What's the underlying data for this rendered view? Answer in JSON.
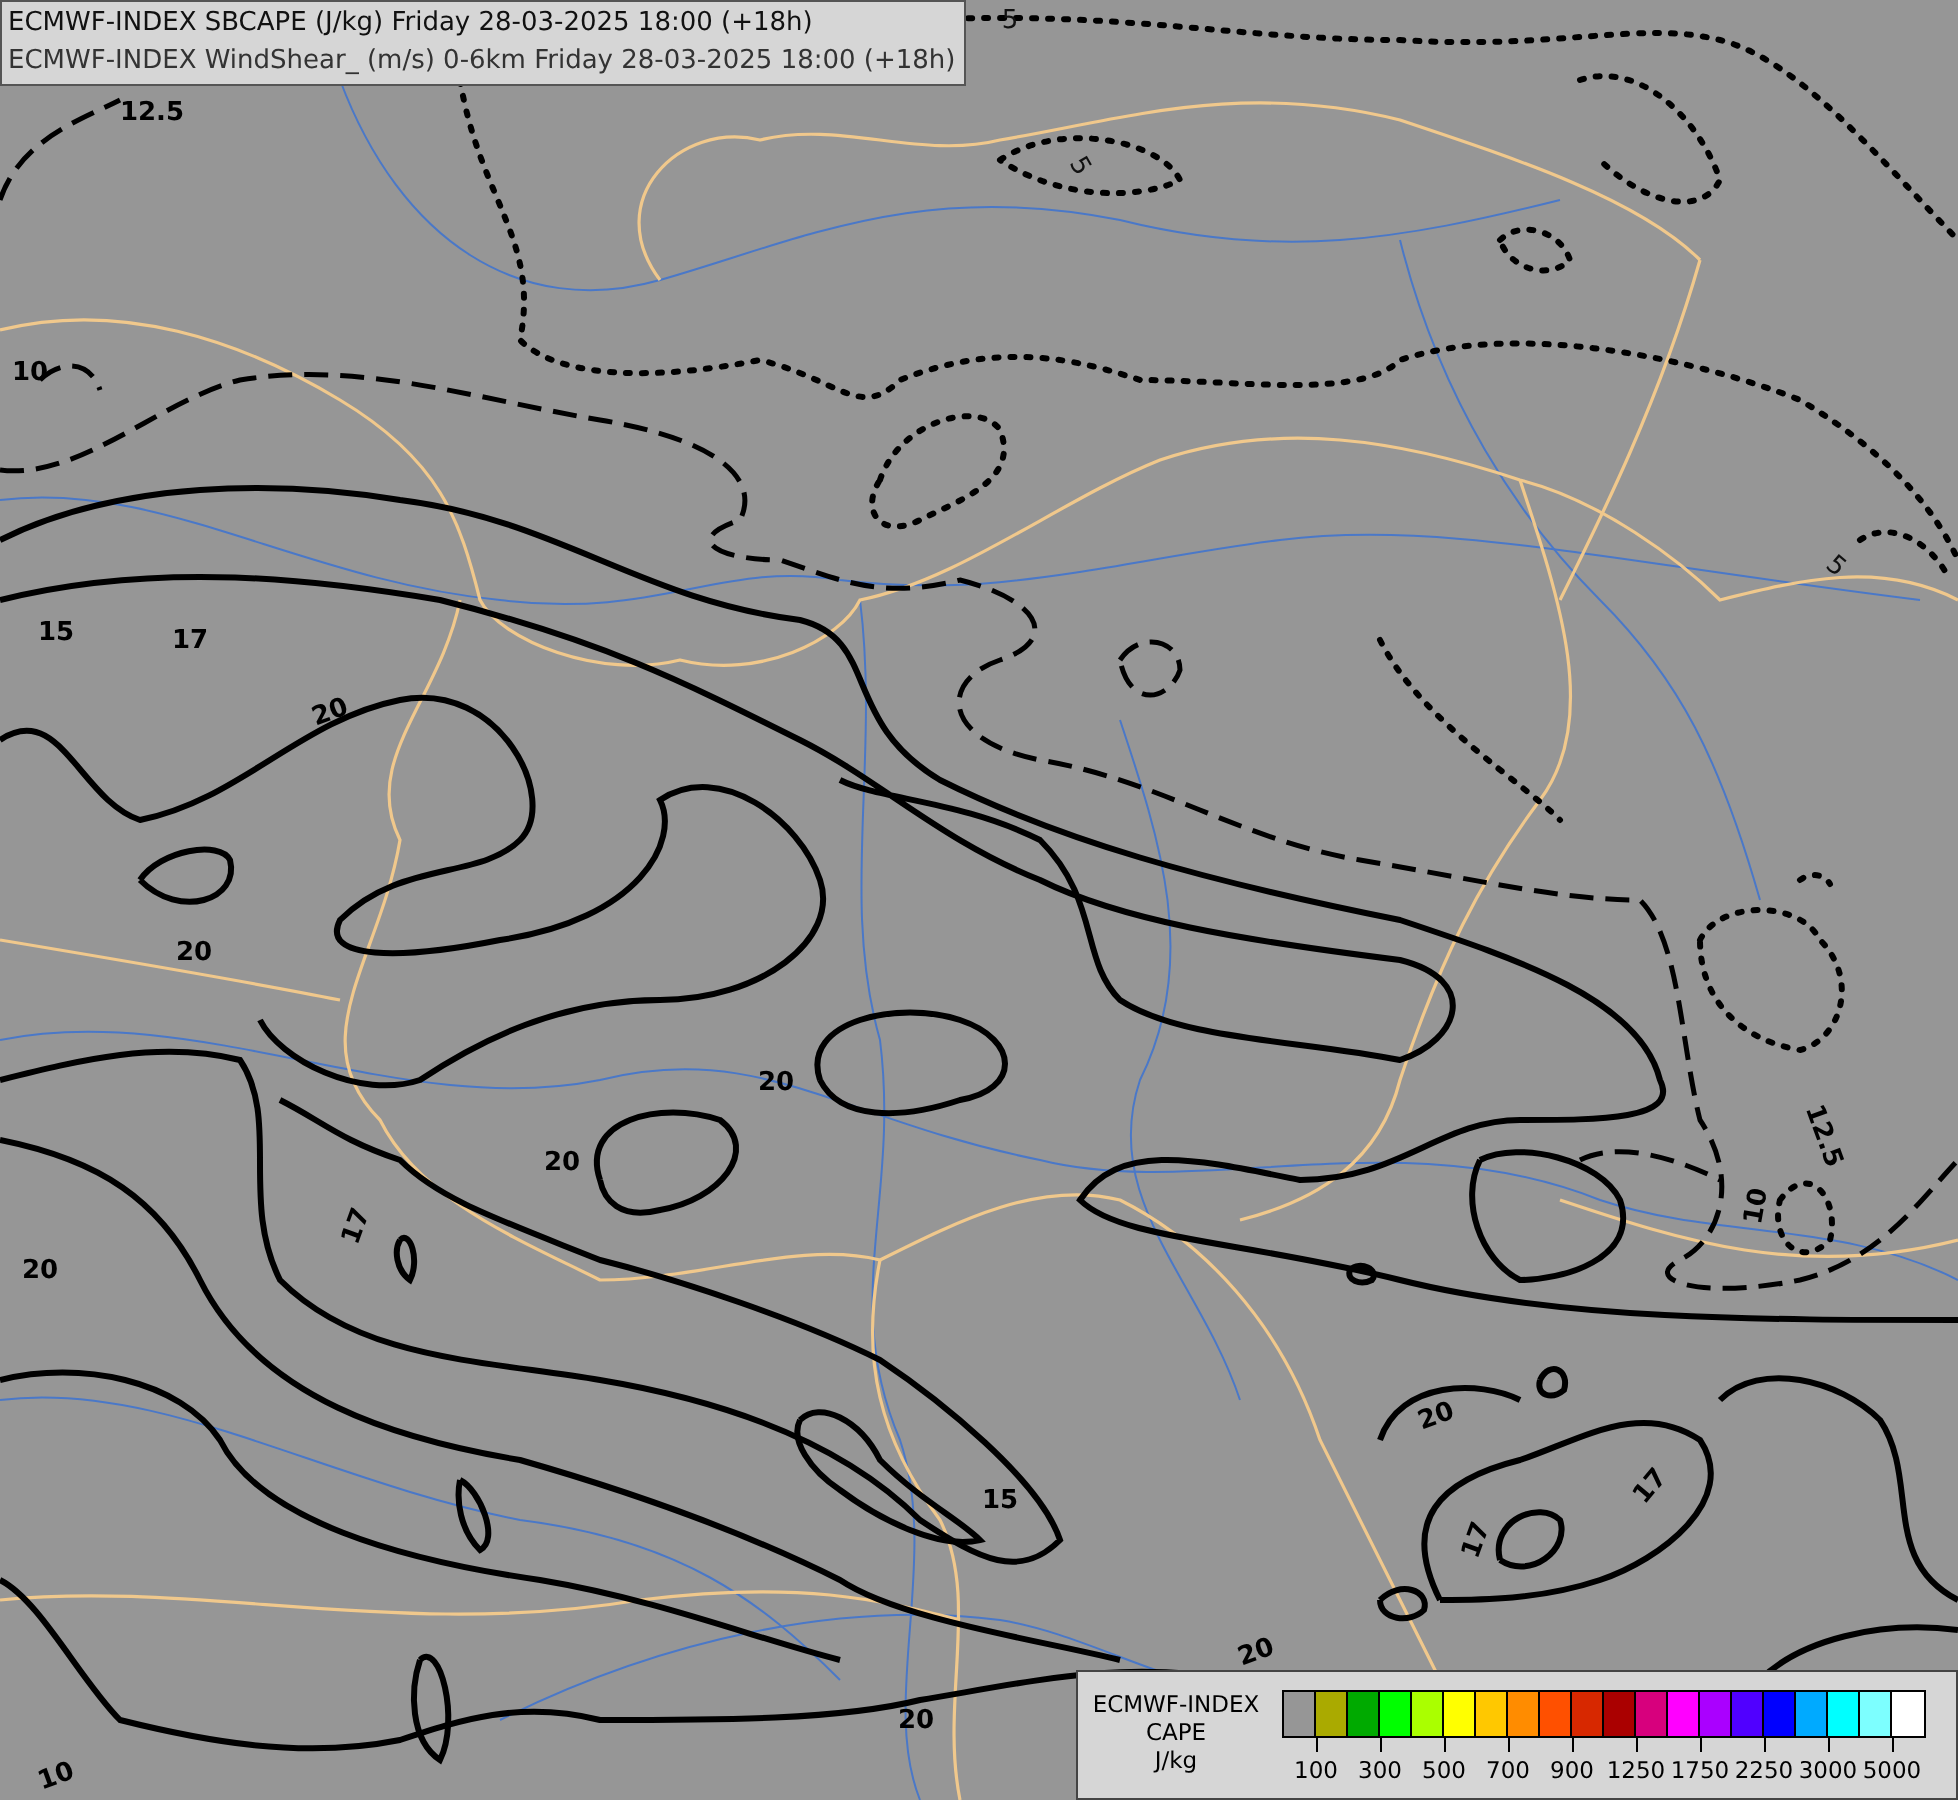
{
  "title_box": {
    "lines": [
      "ECMWF-INDEX SBCAPE (J/kg) Friday 28-03-2025 18:00 (+18h)",
      "ECMWF-INDEX WindShear_ (m/s) 0-6km Friday 28-03-2025 18:00 (+18h)"
    ]
  },
  "contour_labels": [
    {
      "text": "12.5",
      "kind": "dashed"
    },
    {
      "text": "5",
      "kind": "dotted"
    },
    {
      "text": "5",
      "kind": "dotted"
    },
    {
      "text": "10",
      "kind": "dashed"
    },
    {
      "text": "15",
      "kind": "solid"
    },
    {
      "text": "17",
      "kind": "solid"
    },
    {
      "text": "20",
      "kind": "solid"
    },
    {
      "text": "20",
      "kind": "solid"
    },
    {
      "text": "20",
      "kind": "solid"
    },
    {
      "text": "20",
      "kind": "solid"
    },
    {
      "text": "17",
      "kind": "solid"
    },
    {
      "text": "20",
      "kind": "solid"
    },
    {
      "text": "15",
      "kind": "solid"
    },
    {
      "text": "20",
      "kind": "solid"
    },
    {
      "text": "17",
      "kind": "solid"
    },
    {
      "text": "17",
      "kind": "solid"
    },
    {
      "text": "20",
      "kind": "solid"
    },
    {
      "text": "20",
      "kind": "solid"
    },
    {
      "text": "10",
      "kind": "solid"
    },
    {
      "text": "12.5",
      "kind": "dashed"
    },
    {
      "text": "10",
      "kind": "dashed"
    },
    {
      "text": "5",
      "kind": "dotted"
    }
  ],
  "legend": {
    "title_lines": [
      "ECMWF-INDEX",
      "CAPE",
      "J/kg"
    ],
    "swatches": [
      {
        "color": "#969696"
      },
      {
        "color": "#aaaa00"
      },
      {
        "color": "#00aa00"
      },
      {
        "color": "#00ff00"
      },
      {
        "color": "#aaff00"
      },
      {
        "color": "#ffff00"
      },
      {
        "color": "#ffc800"
      },
      {
        "color": "#ff8c00"
      },
      {
        "color": "#ff5000"
      },
      {
        "color": "#d72800"
      },
      {
        "color": "#aa0000"
      },
      {
        "color": "#d7007d"
      },
      {
        "color": "#ff00ff"
      },
      {
        "color": "#aa00ff"
      },
      {
        "color": "#5000ff"
      },
      {
        "color": "#0000ff"
      },
      {
        "color": "#00aaff"
      },
      {
        "color": "#00ffff"
      },
      {
        "color": "#7dffff"
      },
      {
        "color": "#ffffff"
      }
    ],
    "ticks": [
      "100",
      "300",
      "500",
      "700",
      "900",
      "1250",
      "1750",
      "2250",
      "3000",
      "5000"
    ]
  }
}
